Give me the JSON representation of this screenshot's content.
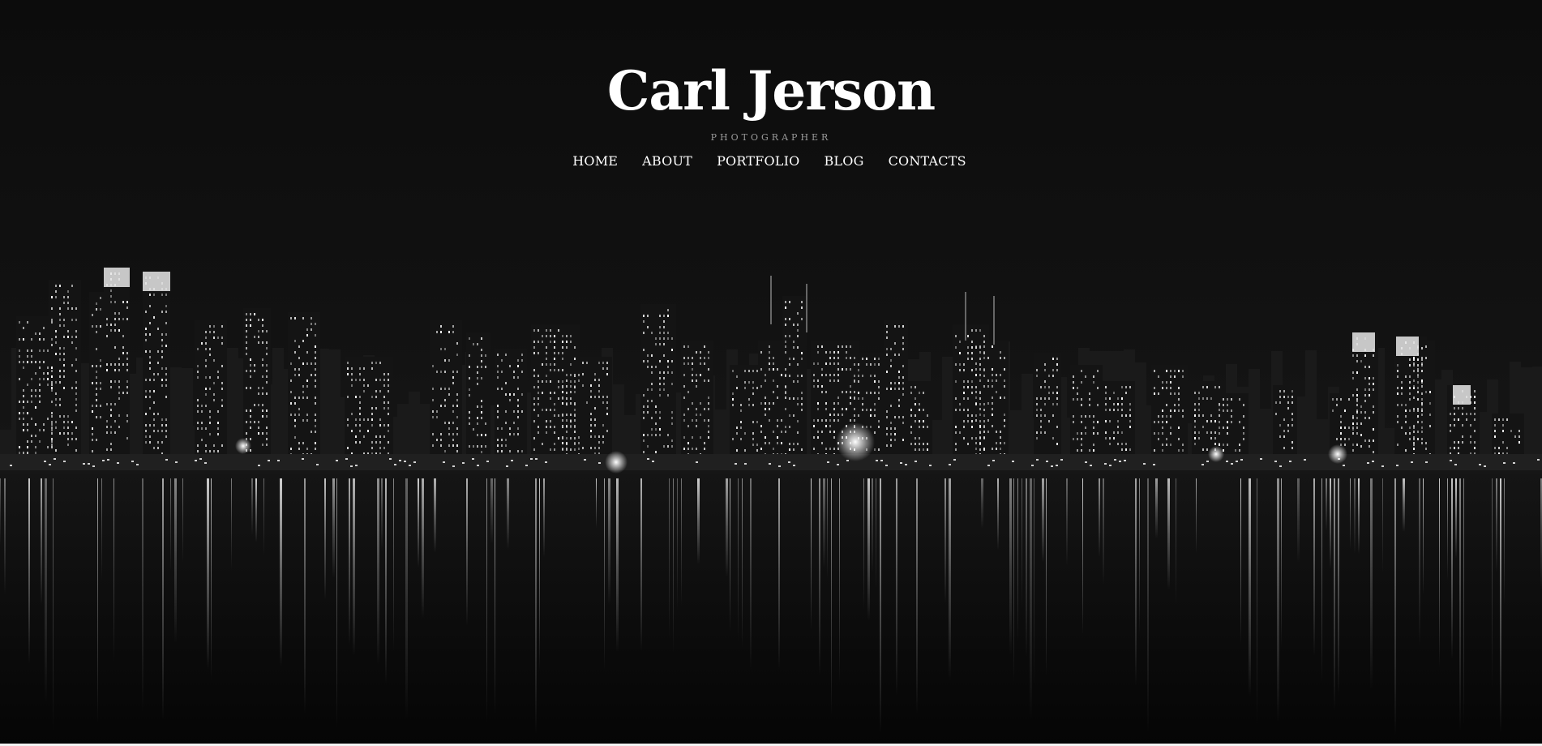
{
  "site": {
    "title": "Carl Jerson",
    "tagline": "PHOTOGRAPHER"
  },
  "nav": {
    "items": [
      {
        "label": "HOME"
      },
      {
        "label": "ABOUT"
      },
      {
        "label": "PORTFOLIO"
      },
      {
        "label": "BLOG"
      },
      {
        "label": "CONTACTS"
      }
    ]
  },
  "hero": {
    "image_subject": "night-city-skyline-with-water-reflections",
    "colors": {
      "sky": "#0d0d0d",
      "water": "#0a0a0a",
      "light": "#e8e8e8"
    }
  }
}
